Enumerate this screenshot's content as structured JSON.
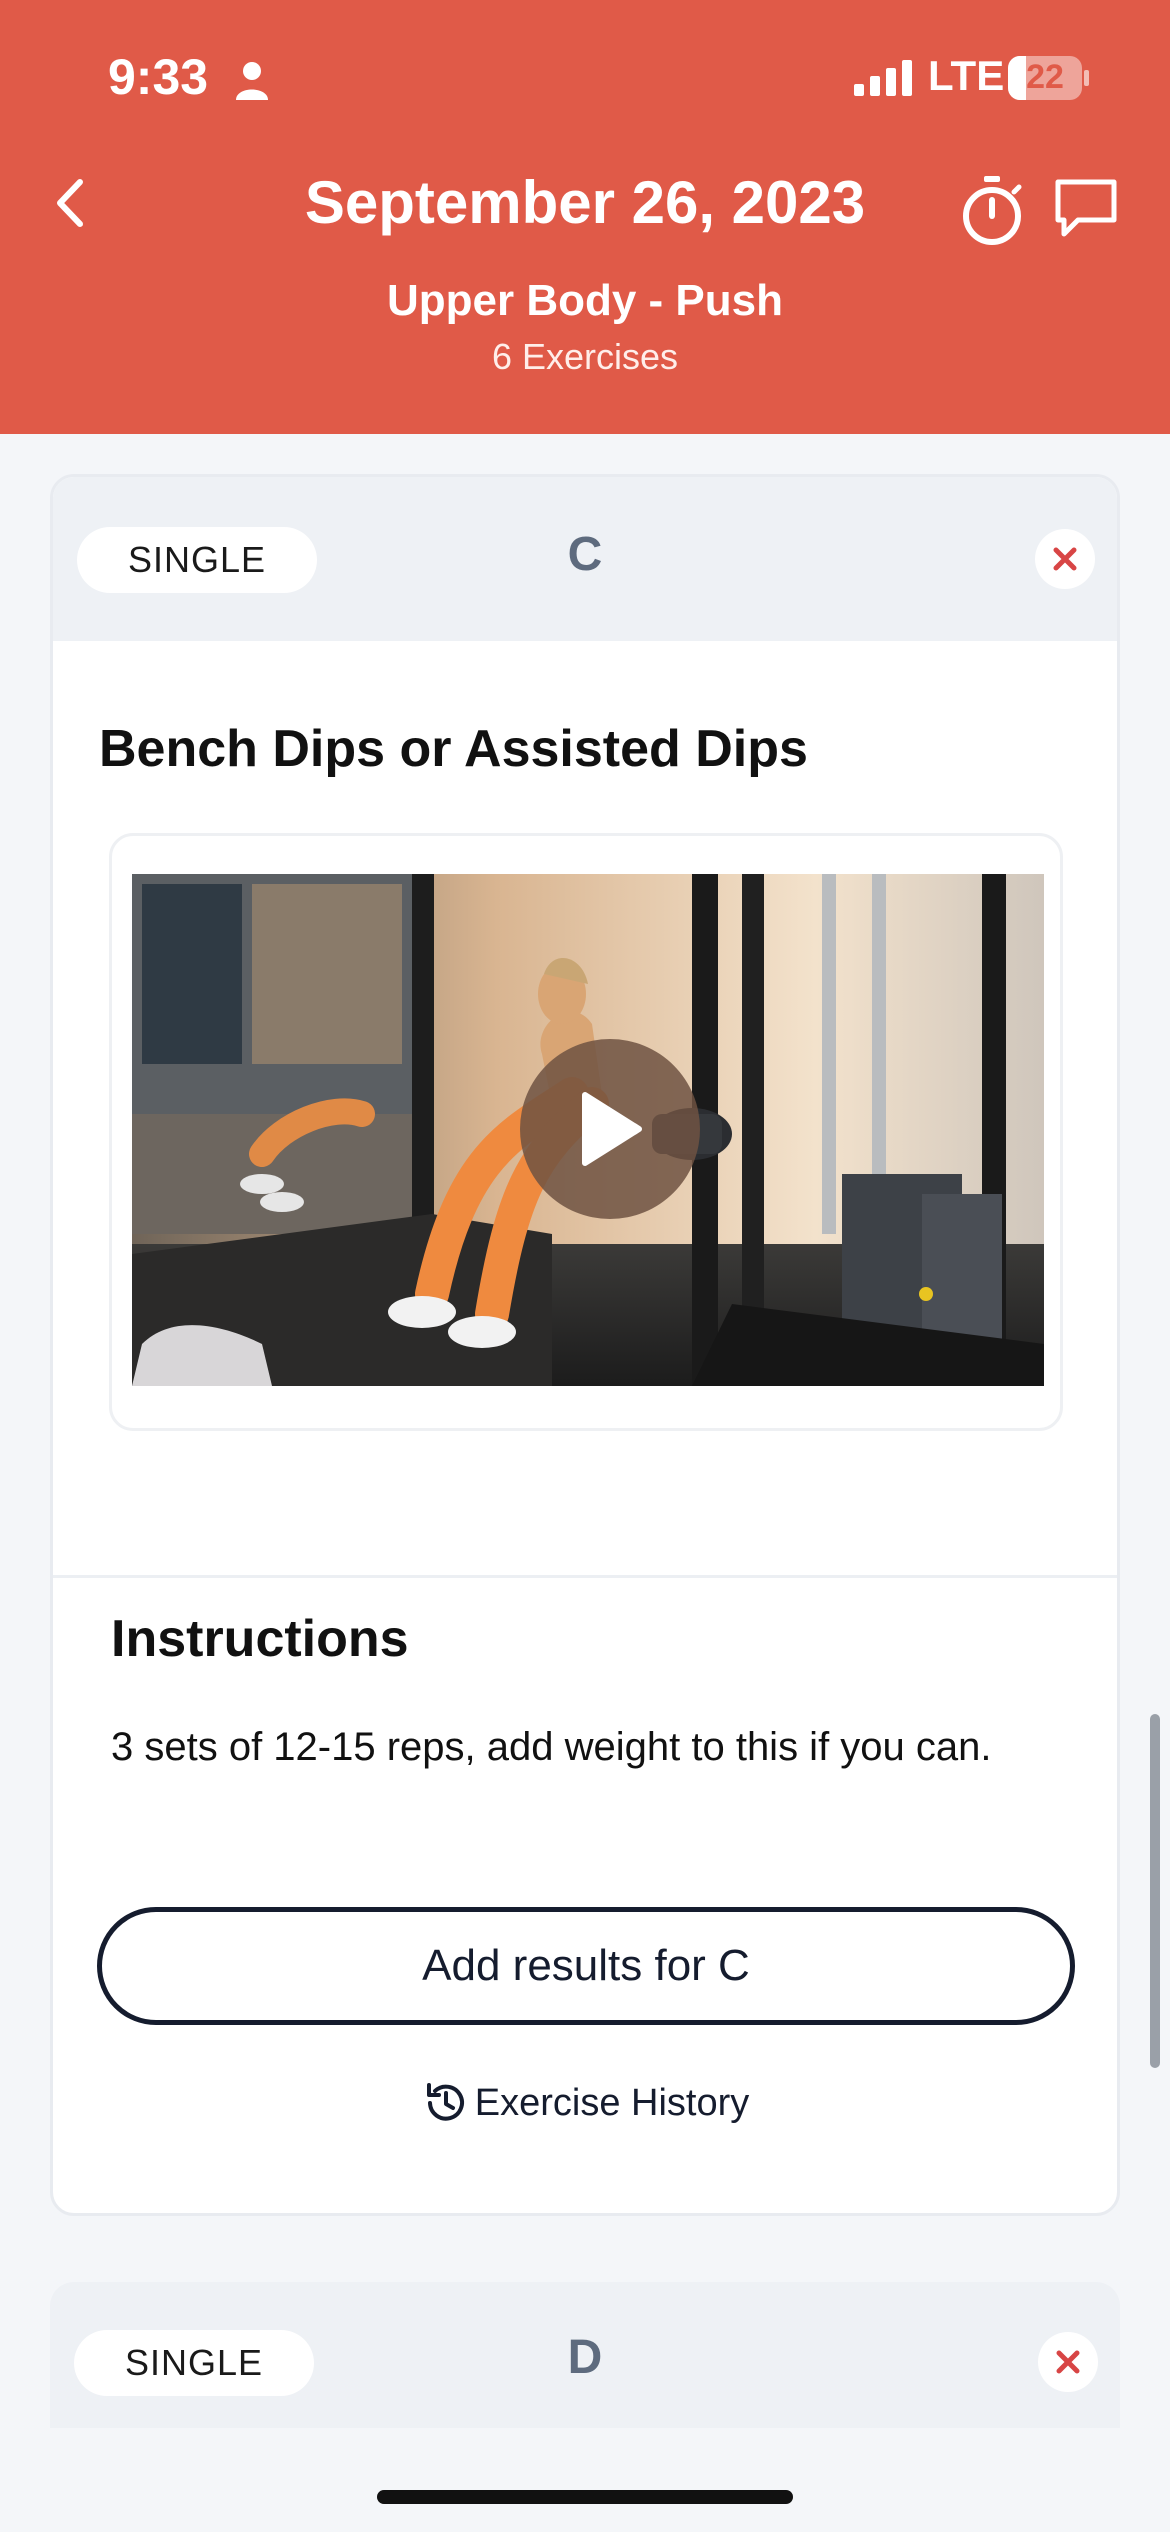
{
  "status_bar": {
    "time": "9:33",
    "network": "LTE",
    "battery_level": "22",
    "battery_fraction": 0.22
  },
  "header": {
    "title": "September 26, 2023",
    "workout_name": "Upper Body - Push",
    "exercise_count": "6 Exercises",
    "background_color": "#e05a48"
  },
  "icons": {
    "back": "chevron-left-icon",
    "timer": "stopwatch-icon",
    "chat": "chat-bubble-icon",
    "close": "close-icon",
    "play": "play-icon",
    "history": "history-icon"
  },
  "cards": [
    {
      "type": "SINGLE",
      "letter": "C",
      "exercise_title": "Bench Dips or Assisted Dips",
      "instructions_heading": "Instructions",
      "instructions_text": "3 sets of 12-15 reps, add weight to this if you can.",
      "results_button": "Add results for C",
      "history_link": "Exercise History"
    },
    {
      "type": "SINGLE",
      "letter": "D"
    }
  ],
  "colors": {
    "accent": "#e05a48",
    "close_x": "#d84545",
    "button_border": "#151c2e"
  }
}
